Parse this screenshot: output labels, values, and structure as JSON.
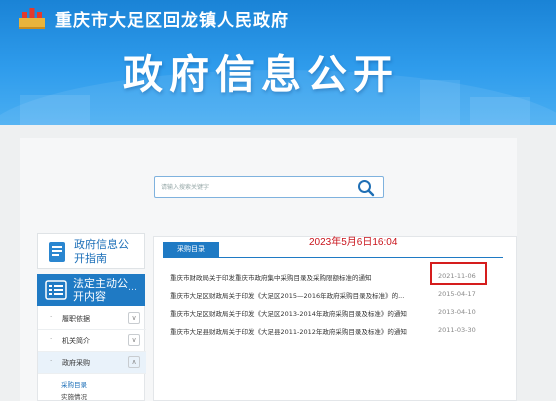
{
  "header": {
    "site_title": "重庆市大足区回龙镇人民政府",
    "banner_title": "政府信息公开"
  },
  "search": {
    "placeholder": "请输入搜索关键字",
    "icon": "search-icon"
  },
  "sidebar": {
    "guide": {
      "label": "政府信息公开指南",
      "icon": "document-icon"
    },
    "main_section": {
      "label": "法定主动公开内容",
      "icon": "list-icon",
      "more": "…"
    },
    "items": [
      {
        "label": "履职依据",
        "expand": "chevron-down-icon"
      },
      {
        "label": "机关简介",
        "expand": "chevron-down-icon"
      },
      {
        "label": "政府采购",
        "expand": "chevron-up-icon"
      }
    ],
    "subitems": [
      {
        "label": "采购目录"
      },
      {
        "label": "实施情况"
      }
    ]
  },
  "content": {
    "tab_label": "采购目录",
    "annotation": "2023年5月6日16:04",
    "rows": [
      {
        "title": "重庆市财政局关于印发重庆市政府集中采购目录及采购限额标准的通知",
        "date": "2021-11-06"
      },
      {
        "title": "重庆市大足区财政局关于印发《大足区2015—2016年政府采购目录及标准》的...",
        "date": "2015-04-17"
      },
      {
        "title": "重庆市大足区财政局关于印发《大足区2013-2014年政府采购目录及标准》的通知",
        "date": "2013-04-10"
      },
      {
        "title": "重庆市大足县财政局关于印发《大足县2011-2012年政府采购目录及标准》的通知",
        "date": "2011-03-30"
      }
    ]
  },
  "colors": {
    "brand_blue": "#1f7ac4",
    "header_blue": "#2f9cec",
    "annotation_red": "#c9141c"
  }
}
